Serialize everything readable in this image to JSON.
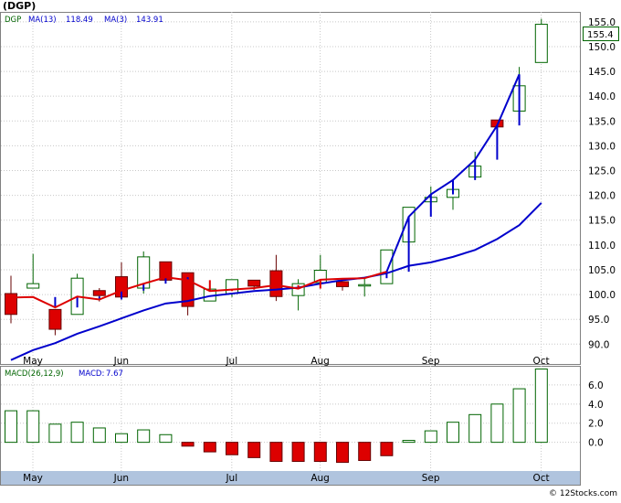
{
  "title": "(DGP)",
  "copyright": "© 12Stocks.com",
  "colors": {
    "up_body": "#ffffff",
    "up_stroke": "#006400",
    "down_body": "#dd0000",
    "ma13": "#0000cc",
    "ma3_up": "#0000cc",
    "ma3_down": "#dd0000",
    "axis_band": "#b0c4de",
    "grid": "#c8c8c8",
    "price_box_border": "#006400"
  },
  "price_legend": {
    "symbol": "DGP",
    "ma13_label": "MA(13)",
    "ma13_value": "118.49",
    "ma3_label": "MA(3)",
    "ma3_value": "143.91"
  },
  "last_price_label": "155.4",
  "macd_legend": {
    "params": "MACD(26,12,9)",
    "label": "MACD:",
    "value": "7.67"
  },
  "month_labels": [
    "May",
    "Jun",
    "Jul",
    "Aug",
    "Sep",
    "Oct"
  ],
  "chart_data": [
    {
      "type": "candlestick",
      "title": "(DGP)",
      "y_ticks": [
        90,
        95,
        100,
        105,
        110,
        115,
        120,
        125,
        130,
        135,
        140,
        145,
        150,
        155
      ],
      "ylim": [
        86,
        157
      ],
      "grid": true,
      "x_labels": [
        "May",
        "",
        "",
        "",
        "Jun",
        "",
        "",
        "",
        "",
        "Jul",
        "",
        "",
        "",
        "Aug",
        "",
        "",
        "",
        "",
        "Sep",
        "",
        "",
        "",
        "",
        "Oct",
        "",
        ""
      ],
      "candles": [
        {
          "open": 100.2,
          "high": 103.8,
          "low": 94.2,
          "close": 96.0
        },
        {
          "open": 101.3,
          "high": 108.2,
          "low": 101.3,
          "close": 102.2
        },
        {
          "open": 97.0,
          "high": 97.0,
          "low": 91.8,
          "close": 93.0
        },
        {
          "open": 96.0,
          "high": 104.2,
          "low": 96.0,
          "close": 103.3
        },
        {
          "open": 100.8,
          "high": 101.3,
          "low": 98.6,
          "close": 99.8
        },
        {
          "open": 103.6,
          "high": 106.5,
          "low": 99.5,
          "close": 99.5
        },
        {
          "open": 101.3,
          "high": 108.7,
          "low": 100.2,
          "close": 107.6
        },
        {
          "open": 106.6,
          "high": 106.6,
          "low": 102.9,
          "close": 102.9
        },
        {
          "open": 104.4,
          "high": 104.4,
          "low": 95.8,
          "close": 97.6
        },
        {
          "open": 98.7,
          "high": 102.8,
          "low": 98.7,
          "close": 101.1
        },
        {
          "open": 100.2,
          "high": 103.0,
          "low": 99.5,
          "close": 103.0
        },
        {
          "open": 102.9,
          "high": 102.9,
          "low": 101.3,
          "close": 101.7
        },
        {
          "open": 104.8,
          "high": 108.0,
          "low": 98.7,
          "close": 99.6
        },
        {
          "open": 99.8,
          "high": 103.1,
          "low": 96.8,
          "close": 102.2
        },
        {
          "open": 102.4,
          "high": 108.0,
          "low": 102.4,
          "close": 104.9
        },
        {
          "open": 102.6,
          "high": 102.6,
          "low": 100.8,
          "close": 101.6
        },
        {
          "open": 102.0,
          "high": 103.3,
          "low": 99.6,
          "close": 102.0
        },
        {
          "open": 102.2,
          "high": 109.0,
          "low": 102.2,
          "close": 109.0
        },
        {
          "open": 110.6,
          "high": 117.6,
          "low": 110.6,
          "close": 117.6
        },
        {
          "open": 118.7,
          "high": 121.8,
          "low": 118.1,
          "close": 119.6
        },
        {
          "open": 119.6,
          "high": 123.3,
          "low": 117.1,
          "close": 121.2
        },
        {
          "open": 123.7,
          "high": 128.8,
          "low": 123.1,
          "close": 125.9
        },
        {
          "open": 135.2,
          "high": 135.2,
          "low": 128.8,
          "close": 133.8
        },
        {
          "open": 137.0,
          "high": 145.9,
          "low": 137.0,
          "close": 142.1
        },
        {
          "open": 146.8,
          "high": 155.6,
          "low": 146.8,
          "close": 154.5
        }
      ],
      "series": [
        {
          "name": "MA(13)",
          "values": [
            86.8,
            88.8,
            90.2,
            92.1,
            93.6,
            95.2,
            96.8,
            98.2,
            98.7,
            99.7,
            100.2,
            100.7,
            101.0,
            101.4,
            102.2,
            102.9,
            103.4,
            104.3,
            105.8,
            106.5,
            107.6,
            109.0,
            111.2,
            114.0,
            118.5
          ]
        },
        {
          "name": "MA(3)",
          "values": [
            99.4,
            99.5,
            97.4,
            99.6,
            99.0,
            100.8,
            102.2,
            103.5,
            102.9,
            100.7,
            101.0,
            101.3,
            101.9,
            101.2,
            103.0,
            103.2,
            103.3,
            104.6,
            115.7,
            120.2,
            123.1,
            127.2,
            134.1,
            144.4
          ]
        }
      ]
    },
    {
      "type": "bar",
      "title": "MACD(26,12,9)",
      "y_ticks": [
        0.0,
        2.0,
        4.0,
        6.0
      ],
      "ylim": [
        -3.0,
        8.0
      ],
      "grid": true,
      "values": [
        3.3,
        3.3,
        1.9,
        2.1,
        1.5,
        0.9,
        1.3,
        0.8,
        -0.4,
        -1.0,
        -1.3,
        -1.6,
        -2.0,
        -2.0,
        -2.0,
        -2.1,
        -1.9,
        -1.4,
        0.2,
        1.2,
        2.1,
        2.9,
        4.0,
        5.6,
        7.67
      ]
    }
  ]
}
